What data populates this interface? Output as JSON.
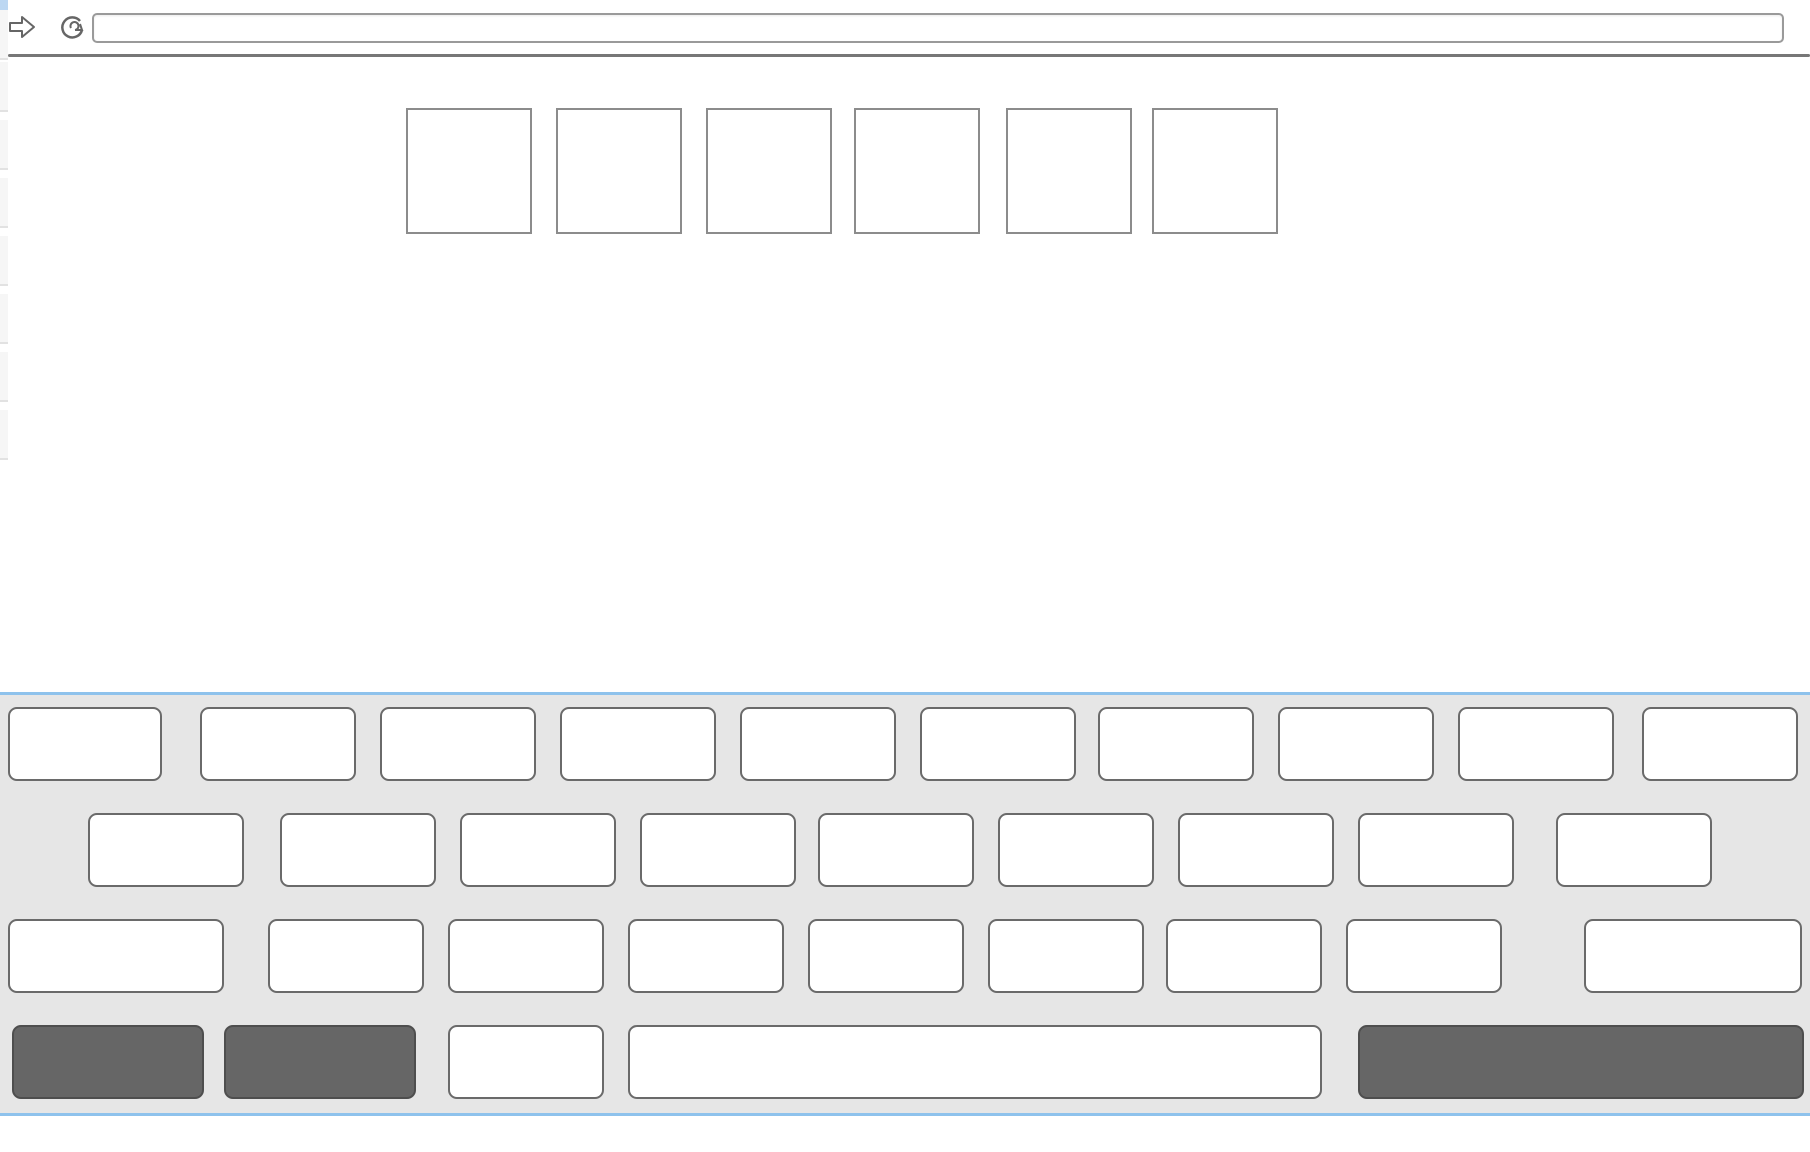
{
  "toolbar": {
    "forward_icon": "arrow-right-icon",
    "refresh_icon": "refresh-icon",
    "address_value": ""
  },
  "tiles": [
    "",
    "",
    "",
    "",
    "",
    ""
  ],
  "keyboard": {
    "rows": [
      [
        "",
        "",
        "",
        "",
        "",
        "",
        "",
        "",
        "",
        ""
      ],
      [
        "",
        "",
        "",
        "",
        "",
        "",
        "",
        "",
        ""
      ],
      [
        "",
        "",
        "",
        "",
        "",
        "",
        "",
        "",
        ""
      ],
      [
        "",
        "",
        "",
        "",
        ""
      ]
    ],
    "colors": {
      "key_background": "#ffffff",
      "dark_key_background": "#666666",
      "keyboard_background": "#e6e6e6",
      "keyboard_border": "#8ec2ec"
    }
  }
}
